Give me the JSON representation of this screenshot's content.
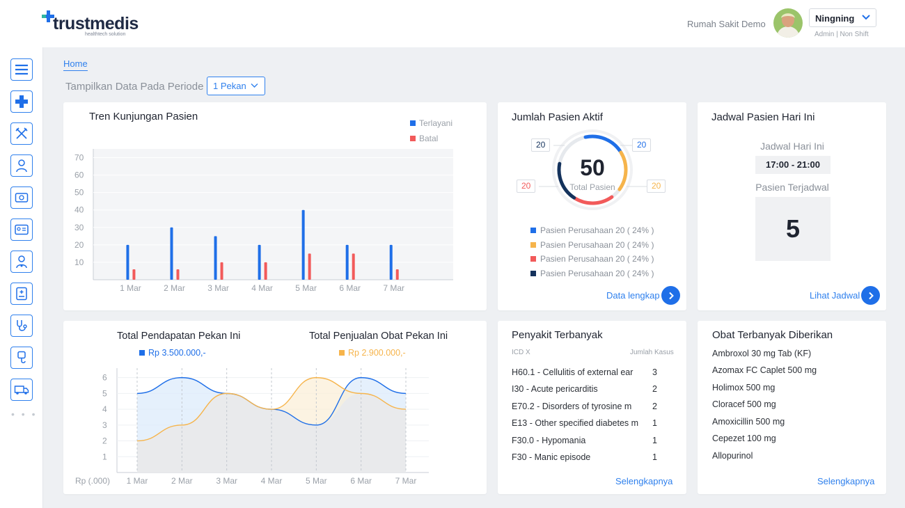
{
  "header": {
    "brand": "trustmedis",
    "brand_tagline": "healthtech solution",
    "hospital": "Rumah Sakit Demo",
    "user_name": "Ningning",
    "user_role": "Admin | Non Shift"
  },
  "sidebar": {
    "items": [
      "menu-icon",
      "trustmedis-cross-icon",
      "tools-icon",
      "doctor-icon",
      "cash-register-icon",
      "id-card-icon",
      "nurse-icon",
      "medical-record-icon",
      "stethoscope-icon",
      "iv-drip-icon",
      "ambulance-icon"
    ],
    "more": "• • •"
  },
  "breadcrumb": "Home",
  "period": {
    "label": "Tampilkan Data Pada Periode",
    "value": "1 Pekan"
  },
  "visits": {
    "title": "Tren Kunjungan Pasien",
    "chart_data": {
      "type": "bar",
      "title": "Tren Kunjungan Pasien",
      "categories": [
        "1 Mar",
        "2 Mar",
        "3 Mar",
        "4 Mar",
        "5 Mar",
        "6 Mar",
        "7 Mar"
      ],
      "yticks": [
        10,
        20,
        30,
        40,
        50,
        60,
        70
      ],
      "ylim": [
        0,
        75
      ],
      "legend": "top-right",
      "series": [
        {
          "name": "Terlayani",
          "color": "#1f6fe8",
          "values": [
            20,
            30,
            25,
            20,
            40,
            20,
            20
          ]
        },
        {
          "name": "Batal",
          "color": "#f25a5a",
          "values": [
            6,
            6,
            10,
            10,
            15,
            15,
            6
          ]
        }
      ]
    }
  },
  "active_patients": {
    "title": "Jumlah Pasien Aktif",
    "total": "50",
    "total_label": "Total Pasien",
    "tags": [
      "20",
      "20",
      "20",
      "20"
    ],
    "chart_data": {
      "type": "pie",
      "values": [
        20,
        20,
        20,
        20
      ],
      "colors": [
        "#1f6fe8",
        "#f6b44b",
        "#f25a5a",
        "#14325c"
      ]
    },
    "legend": [
      {
        "label": "Pasien Perusahaan 20 ( 24% )",
        "color": "#1f6fe8"
      },
      {
        "label": "Pasien Perusahaan 20 ( 24% )",
        "color": "#f6b44b"
      },
      {
        "label": "Pasien Perusahaan 20 ( 24% )",
        "color": "#f25a5a"
      },
      {
        "label": "Pasien Perusahaan 20 ( 24% )",
        "color": "#14325c"
      }
    ],
    "link": "Data lengkap"
  },
  "schedule": {
    "title": "Jadwal Pasien Hari Ini",
    "today_label": "Jadwal Hari Ini",
    "time": "17:00 - 21:00",
    "scheduled_label": "Pasien Terjadwal",
    "scheduled_count": "5",
    "link": "Lihat Jadwal"
  },
  "revenue": {
    "title_revenue": "Total Pendapatan Pekan Ini",
    "value_revenue": "Rp 3.500.000,-",
    "title_sales": "Total Penjualan Obat Pekan Ini",
    "value_sales": "Rp 2.900.000,-",
    "chart_data": {
      "type": "area",
      "x": [
        "1 Mar",
        "2 Mar",
        "3 Mar",
        "4 Mar",
        "5 Mar",
        "6 Mar",
        "7 Mar"
      ],
      "xlabel": "Rp (.000)",
      "yticks": [
        1,
        2,
        3,
        4,
        5,
        6
      ],
      "ylim": [
        0,
        6.6
      ],
      "series": [
        {
          "name": "Total Pendapatan Pekan Ini",
          "color": "#1f6fe8",
          "values": [
            5,
            6,
            5,
            4,
            3,
            6,
            5
          ]
        },
        {
          "name": "Total Penjualan Obat Pekan Ini",
          "color": "#f6b44b",
          "values": [
            2,
            3,
            5,
            4,
            6,
            5,
            4
          ]
        }
      ]
    }
  },
  "diseases": {
    "title": "Penyakit Terbanyak",
    "col_code": "ICD X",
    "col_count": "Jumlah Kasus",
    "rows": [
      {
        "name": "H60.1 - Cellulitis of external ear",
        "count": "3"
      },
      {
        "name": "I30 - Acute pericarditis",
        "count": "2"
      },
      {
        "name": "E70.2 - Disorders of tyrosine m",
        "count": "2"
      },
      {
        "name": "E13 - Other specified diabetes m",
        "count": "1"
      },
      {
        "name": "F30.0 - Hypomania",
        "count": "1"
      },
      {
        "name": "F30 - Manic episode",
        "count": "1"
      }
    ],
    "link": "Selengkapnya"
  },
  "drugs": {
    "title": "Obat Terbanyak Diberikan",
    "items": [
      "Ambroxol 30 mg Tab (KF)",
      "Azomax FC Caplet 500 mg",
      "Holimox 500 mg",
      "Cloracef 500 mg",
      "Amoxicillin 500 mg",
      "Cepezet 100 mg",
      "Allopurinol"
    ],
    "link": "Selengkapnya"
  }
}
